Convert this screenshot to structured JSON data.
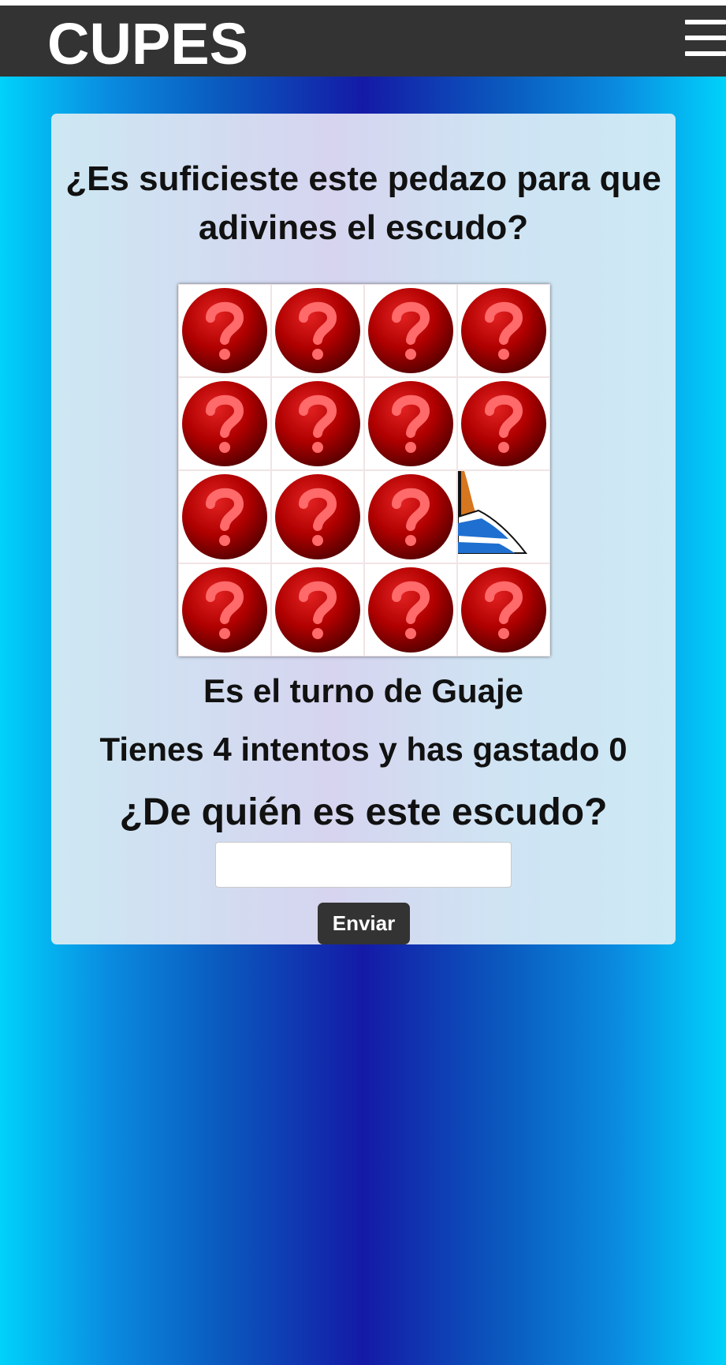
{
  "header": {
    "logo": "CUPES",
    "menu_icon": "hamburger-menu-icon"
  },
  "game": {
    "question": "¿Es suficieste este pedazo para que adivines el escudo?",
    "grid": {
      "rows": 4,
      "cols": 4,
      "hidden_icon": "question-mark-icon",
      "revealed_tiles": [
        {
          "row": 3,
          "col": 4,
          "content": "crest-fragment"
        }
      ]
    },
    "turn_text": "Es el turno de Guaje",
    "attempts_text": "Tienes 4 intentos y has gastado 0",
    "prompt": "¿De quién es este escudo?",
    "answer_value": "",
    "submit_label": "Enviar"
  },
  "colors": {
    "header_bg": "#333333",
    "question_ball": "#b00000",
    "question_mark": "#ff6a6a",
    "crest_blue": "#1e6fd0",
    "crest_orange": "#d6761e"
  }
}
